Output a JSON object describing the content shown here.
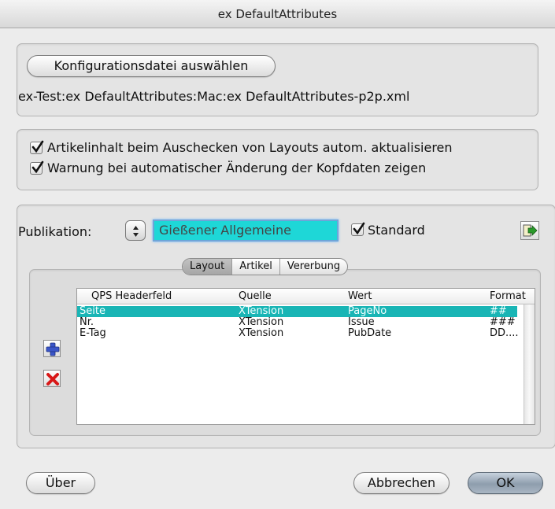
{
  "window": {
    "title": "ex DefaultAttributes"
  },
  "config": {
    "select_button_label": "Konfigurationsdatei auswählen",
    "file_path": "ex-Test:ex DefaultAttributes:Mac:ex DefaultAttributes-p2p.xml"
  },
  "options": {
    "items": [
      {
        "label": "Artikelinhalt beim Auschecken von Layouts autom. aktualisieren",
        "checked": true
      },
      {
        "label": "Warnung bei automatischer Änderung der Kopfdaten zeigen",
        "checked": true
      }
    ]
  },
  "publication": {
    "label": "Publikation:",
    "value": "Gießener Allgemeine",
    "standard_label": "Standard",
    "standard_checked": true,
    "tabs": [
      "Layout",
      "Artikel",
      "Vererbung"
    ],
    "active_tab": "Layout",
    "table": {
      "columns": [
        "QPS Headerfeld",
        "Quelle",
        "Wert",
        "Format"
      ],
      "rows": [
        {
          "field": "Seite",
          "source": "XTension",
          "value": "PageNo",
          "format": "##",
          "selected": true
        },
        {
          "field": "Nr.",
          "source": "XTension",
          "value": "Issue",
          "format": "###",
          "selected": false
        },
        {
          "field": "E-Tag",
          "source": "XTension",
          "value": "PubDate",
          "format": "DD....",
          "selected": false
        }
      ]
    }
  },
  "footer": {
    "about_label": "Über",
    "cancel_label": "Abbrechen",
    "ok_label": "OK"
  },
  "colors": {
    "selection": "#19b5b5",
    "field_highlight": "#1ed7d7",
    "add_icon": "#3a55c8",
    "remove_icon": "#d81818",
    "export_icon": "#2a9a2a"
  },
  "icons": {
    "add": "plus-icon",
    "remove": "x-icon",
    "export": "export-icon"
  }
}
